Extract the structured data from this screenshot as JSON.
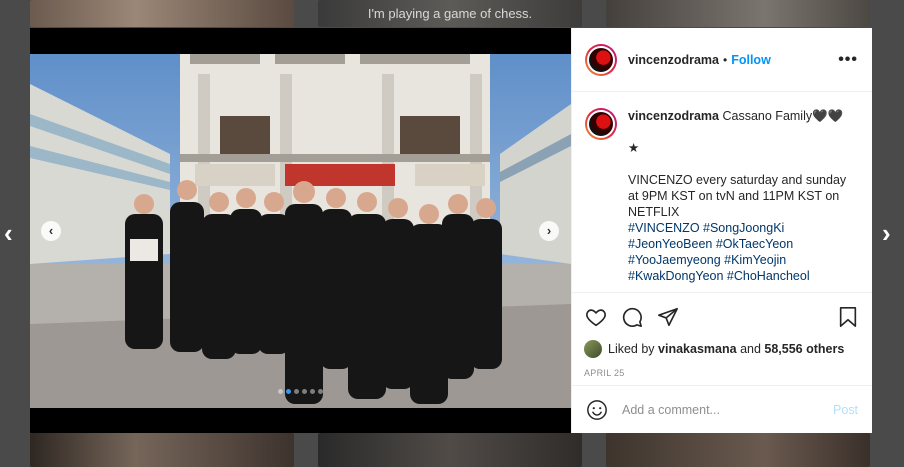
{
  "background": {
    "caption": "I'm playing a game of chess.",
    "prev_page_glyph": "‹",
    "next_page_glyph": "›"
  },
  "post": {
    "username": "vincenzodrama",
    "follow_label": "Follow",
    "more_glyph": "•••",
    "caption": {
      "title": "Cassano Family🖤🖤",
      "star": "★",
      "line1": "VINCENZO every saturday and sunday",
      "line2": "at 9PM KST on tvN and 11PM KST on",
      "line3": "NETFLIX",
      "hashtags": [
        "#VINCENZO #SongJoongKi",
        "#JeonYeoBeen #OkTaecYeon",
        "#YooJaemyeong #KimYeojin",
        "#KwakDongYeon #ChoHancheol"
      ]
    },
    "likes": {
      "prefix": "Liked by",
      "user": "vinakasmana",
      "middle": "and",
      "count": "58,556 others"
    },
    "date": "APRIL 25",
    "carousel": {
      "total": 6,
      "active_index": 1,
      "prev_glyph": "‹",
      "next_glyph": "›"
    },
    "comment": {
      "placeholder": "Add a comment...",
      "post_label": "Post"
    },
    "icons": [
      "heart-icon",
      "comment-icon",
      "share-icon",
      "bookmark-icon",
      "emoji-icon"
    ],
    "colors": {
      "accent": "#0095f6",
      "hashtag": "#00376b",
      "post_disabled": "#b2dffc"
    }
  }
}
